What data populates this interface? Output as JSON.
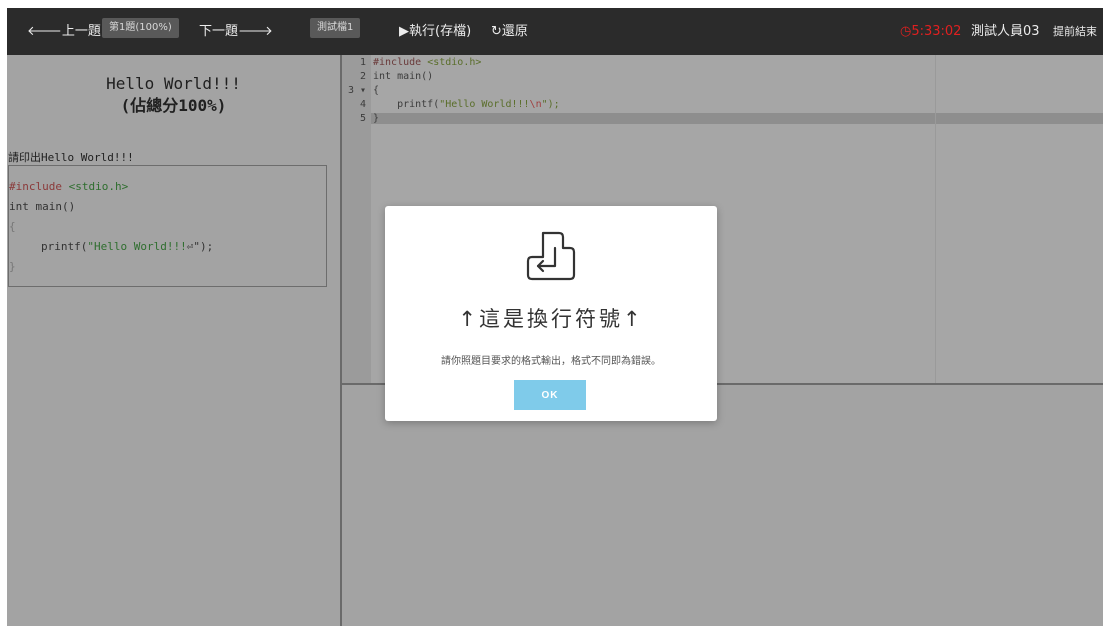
{
  "toolbar": {
    "prev_label": "🡐上一題",
    "question_badge": "第1題(100%)",
    "next_label": "下一題🡒",
    "test_badge": "測試檔1",
    "run_label": "▶執行(存檔)",
    "restore_label": "↻還原",
    "timer": "◷5:33:02",
    "user_name": "測試人員03",
    "finish_label": "提前結束"
  },
  "question": {
    "title": "Hello World!!!",
    "score": "(佔總分100%)",
    "description": "請印出Hello World!!!",
    "sample_code": {
      "line1_directive": "#include",
      "line1_header": "<stdio.h>",
      "line2": "int main()",
      "line3": "{",
      "line4_call": "printf(",
      "line4_string": "\"Hello World!!!",
      "line4_symbol": "⏎",
      "line4_end": "\");",
      "line5": "}"
    }
  },
  "editor": {
    "line_numbers": [
      "1",
      "2",
      "3 ▾",
      "4",
      "5"
    ],
    "lines": {
      "l1_directive": "#include",
      "l1_header": " <stdio.h>",
      "l2": "int main()",
      "l3": "{",
      "l4_indent": "    printf(",
      "l4_string": "\"Hello World!!!",
      "l4_escape": "\\n",
      "l4_end": "\");",
      "l5": "}"
    }
  },
  "modal": {
    "icon": "newline-return-icon",
    "title": "↑這是換行符號↑",
    "message": "請你照題目要求的格式輸出，格式不同即為錯誤。",
    "ok_label": "OK"
  },
  "colors": {
    "topbar": "#2b2b2b",
    "timer": "#e02020",
    "ok_button": "#7fcbea",
    "overlay": "#a3a3a3"
  }
}
